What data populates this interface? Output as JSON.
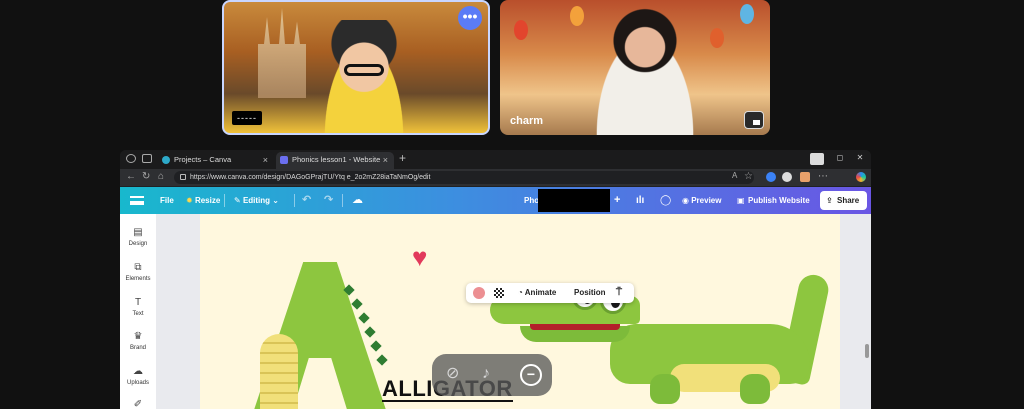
{
  "video": {
    "left_tile": {
      "more_label": "•••",
      "name": "-----"
    },
    "right_tile": {
      "name": "charm"
    }
  },
  "browser": {
    "tabs": [
      {
        "label": "Projects – Canva",
        "active": false
      },
      {
        "label": "Phonics lesson1 - Website",
        "active": true
      }
    ],
    "new_tab": "+",
    "url": "https://www.canva.com/design/DAGoGPrajTU/Ytq e_2o2mZ28iaTaNmOg/edit",
    "accent": "#2e2f32"
  },
  "canva": {
    "header": {
      "file": "File",
      "resize": "Resize",
      "editing": "Editing",
      "title_partial": "Pho",
      "preview": "Preview",
      "publish": "Publish Website",
      "share": "Share"
    },
    "sidebar": [
      {
        "label": "Design",
        "icon": "layout-icon"
      },
      {
        "label": "Elements",
        "icon": "shapes-icon"
      },
      {
        "label": "Text",
        "icon": "text-icon"
      },
      {
        "label": "Brand",
        "icon": "crown-icon"
      },
      {
        "label": "Uploads",
        "icon": "cloud-upload-icon"
      }
    ],
    "toolbar": {
      "animate": "Animate",
      "position": "Position"
    },
    "canvas": {
      "title": "ALLIGATOR"
    }
  },
  "colors": {
    "header_start": "#18b8cd",
    "header_end": "#6a56e4",
    "page_bg": "#fff8de",
    "croc_green": "#8dc63f",
    "heart": "#e23a5b"
  }
}
